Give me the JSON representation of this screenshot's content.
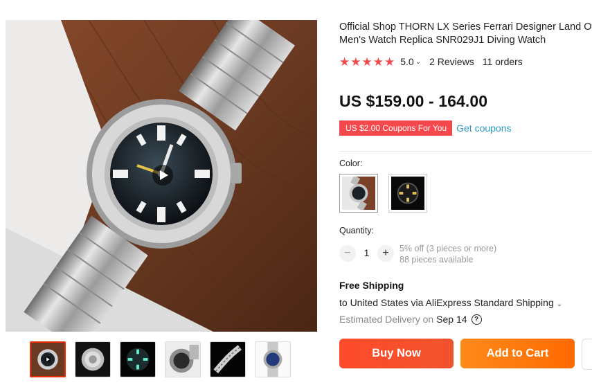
{
  "product": {
    "title_line1": "Official Shop THORN LX Series Ferrari Designer Land Ove",
    "title_line2": "Men's Watch Replica SNR029J1 Diving Watch",
    "rating": {
      "stars": 5,
      "value": "5.0",
      "reviews": "2 Reviews",
      "orders": "11 orders",
      "star_color": "#f5484d"
    },
    "price": "US $159.00 - 164.00",
    "coupon": {
      "badge": "US $2.00 Coupons For You",
      "link": "Get coupons"
    },
    "color_label": "Color:",
    "quantity": {
      "label": "Quantity:",
      "value": "1",
      "discount": "5% off (3 pieces or more)",
      "available": "88 pieces available"
    },
    "shipping": {
      "title": "Free Shipping",
      "method": "to United States via AliExpress Standard Shipping",
      "delivery_label": "Estimated Delivery on",
      "delivery_date": "Sep 14"
    },
    "buttons": {
      "buy_now": "Buy Now",
      "add_to_cart": "Add to Cart"
    }
  },
  "gallery": {
    "thumbnail_count": 6,
    "active_index": 0
  },
  "icons": {
    "play": "play-icon",
    "help": "question-circle-icon",
    "caret": "chevron-down-icon",
    "minus": "minus-icon",
    "plus": "plus-icon"
  },
  "colors": {
    "accent_red": "#f5484d",
    "buy_now": "#f44d2c",
    "add_to_cart": "#ff7a10",
    "link_blue": "#2e9cc3"
  }
}
